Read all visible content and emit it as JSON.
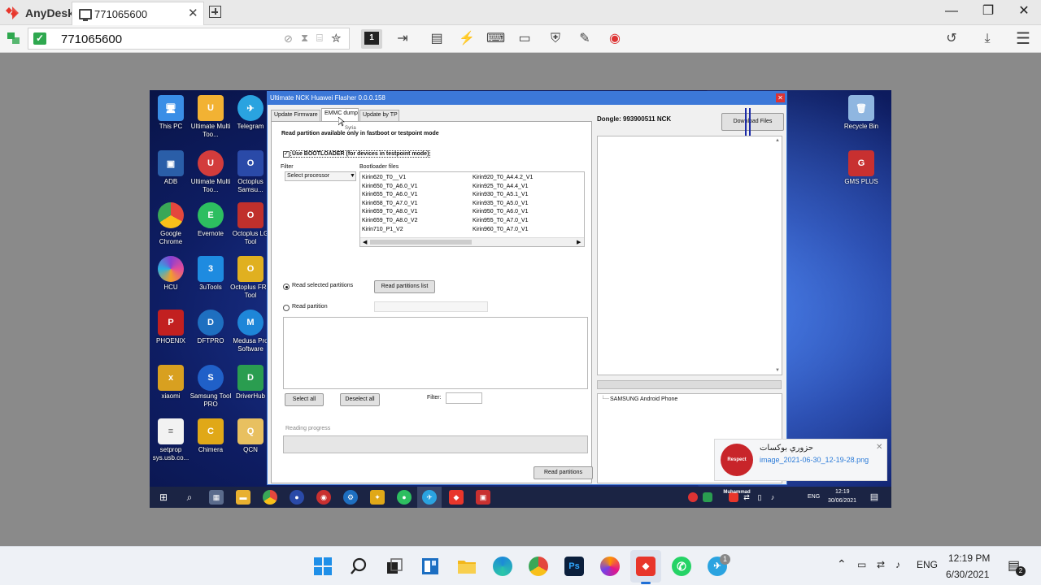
{
  "anydesk": {
    "brand": "AnyDesk",
    "tab_title": "771065600",
    "tab_close": "✕",
    "address_value": "771065600",
    "window_controls": {
      "minimize": "—",
      "maximize": "❐",
      "close": "✕"
    }
  },
  "remote": {
    "desktop_icons": [
      {
        "label": "This PC",
        "color": "#3a8ee6",
        "glyph": "🖥"
      },
      {
        "label": "Ultimate Multi Too...",
        "color": "#f2b233",
        "glyph": "U"
      },
      {
        "label": "Telegram",
        "color": "#2aa3e0",
        "glyph": "✈"
      },
      {
        "label": "ADB",
        "color": "#2a5ea8",
        "glyph": "▣"
      },
      {
        "label": "Ultimate Multi Too...",
        "color": "#d33c3c",
        "glyph": "U"
      },
      {
        "label": "Octoplus Samsu...",
        "color": "#2a4aa8",
        "glyph": "O"
      },
      {
        "label": "Google Chrome",
        "color": "#e4473d",
        "glyph": "◉"
      },
      {
        "label": "Evernote",
        "color": "#2dbe60",
        "glyph": "E"
      },
      {
        "label": "Octoplus LG Tool",
        "color": "#c0302c",
        "glyph": "O"
      },
      {
        "label": "HCU",
        "color": "#8a3fd1",
        "glyph": "H"
      },
      {
        "label": "3uTools",
        "color": "#1e8be0",
        "glyph": "3"
      },
      {
        "label": "Octoplus FRP Tool",
        "color": "#e0b020",
        "glyph": "O"
      },
      {
        "label": "PHOENIX",
        "color": "#c22020",
        "glyph": "P"
      },
      {
        "label": "DFTPRO",
        "color": "#1e6fc0",
        "glyph": "D"
      },
      {
        "label": "Medusa Pro Software",
        "color": "#1e86d8",
        "glyph": "M"
      },
      {
        "label": "xiaomi",
        "color": "#d8a020",
        "glyph": "x"
      },
      {
        "label": "Samsung Tool PRO",
        "color": "#2060c8",
        "glyph": "S"
      },
      {
        "label": "DriverHub",
        "color": "#2a9d50",
        "glyph": "D"
      },
      {
        "label": "setprop sys.usb.co...",
        "color": "#f2f2f2",
        "glyph": "≡"
      },
      {
        "label": "Chimera",
        "color": "#e0a818",
        "glyph": "C"
      },
      {
        "label": "QCN",
        "color": "#e8c060",
        "glyph": "Q"
      },
      {
        "label": "Recycle Bin",
        "color": "#8fb6e0",
        "glyph": "🗑"
      },
      {
        "label": "GMS PLUS",
        "color": "#c83030",
        "glyph": "G"
      }
    ],
    "app": {
      "title": "Ultimate NCK Huawei Flasher 0.0.0.158",
      "close": "✕",
      "tabs": [
        "Update Firmware",
        "EMMC dump",
        "Update by TP"
      ],
      "tooltip": "Syria",
      "heading": "Read partition available only in fastboot or testpoint mode",
      "bootloader_check": "Use BOOTLOADER (for devices in testpoint mode)",
      "filter_label": "Filter",
      "select_processor": "Select processor",
      "bootloader_files_label": "Bootloader files",
      "bootloader_col1": [
        "Kirin620_T0__V1",
        "Kirin650_T0_A6.0_V1",
        "Kirin655_T0_A6.0_V1",
        "Kirin658_T0_A7.0_V1",
        "Kirin659_T0_A8.0_V1",
        "Kirin659_T0_A8.0_V2",
        "Kirin710_P1_V2"
      ],
      "bootloader_col2": [
        "Kirin920_T0_A4.4.2_V1",
        "Kirin925_T0_A4.4_V1",
        "Kirin930_T0_A5.1_V1",
        "Kirin935_T0_A5.0_V1",
        "Kirin950_T0_A6.0_V1",
        "Kirin955_T0_A7.0_V1",
        "Kirin960_T0_A7.0_V1"
      ],
      "read_selected_partitions": "Read selected partitions",
      "read_partitions_list": "Read partitions list",
      "read_partition": "Read partition",
      "select_all": "Select all",
      "deselect_all": "Deselect all",
      "filter2": "Filter:",
      "reading_progress": "Reading progress",
      "read_partitions_button": "Read partitions",
      "dongle": "Dongle: 993900511 NCK",
      "download_files": "Download Files",
      "device_item": "SAMSUNG Android Phone"
    },
    "notification": {
      "title": "حزوري بوكسات",
      "file": "image_2021-06-30_12-19-28.png",
      "close": "✕",
      "badge_text": "Respect Muhammad"
    },
    "taskbar": {
      "lang": "ENG",
      "time": "12:19",
      "date": "30/06/2021"
    }
  },
  "local_taskbar": {
    "lang": "ENG",
    "time": "12:19 PM",
    "date": "6/30/2021",
    "telegram_badge": "1",
    "notif_badge": "2"
  }
}
